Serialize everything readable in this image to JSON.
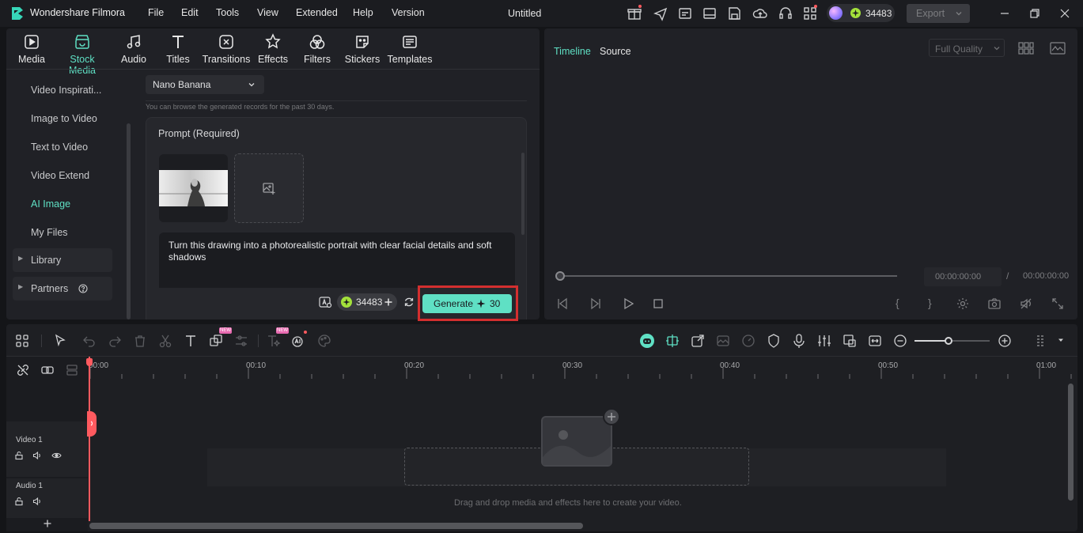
{
  "app": {
    "name": "Wondershare Filmora",
    "doc_title": "Untitled",
    "credits": "34483",
    "export_label": "Export"
  },
  "menu": [
    "File",
    "Edit",
    "Tools",
    "View",
    "Extended",
    "Help",
    "Version"
  ],
  "categories": [
    {
      "label": "Media",
      "icon": "media-icon"
    },
    {
      "label": "Stock Media",
      "icon": "stock-media-icon"
    },
    {
      "label": "Audio",
      "icon": "audio-icon"
    },
    {
      "label": "Titles",
      "icon": "titles-icon"
    },
    {
      "label": "Transitions",
      "icon": "transitions-icon"
    },
    {
      "label": "Effects",
      "icon": "effects-icon"
    },
    {
      "label": "Filters",
      "icon": "filters-icon"
    },
    {
      "label": "Stickers",
      "icon": "stickers-icon"
    },
    {
      "label": "Templates",
      "icon": "templates-icon"
    }
  ],
  "sidebar": {
    "items": [
      "Video Inspirati...",
      "Image to Video",
      "Text to Video",
      "Video Extend",
      "AI Image",
      "My Files"
    ],
    "active": "AI Image",
    "groups": [
      "Library",
      "Partners"
    ]
  },
  "ai_image": {
    "model": "Nano Banana",
    "hint": "You can browse the generated records for the past 30 days.",
    "prompt_label": "Prompt (Required)",
    "prompt_text": "Turn this drawing into a photorealistic portrait with clear facial details and soft shadows",
    "credits": "34483",
    "generate_label": "Generate",
    "generate_cost": "30"
  },
  "player": {
    "tabs": [
      "Timeline",
      "Source"
    ],
    "quality": "Full Quality",
    "current_time": "00:00:00:00",
    "separator": "/",
    "total_time": "00:00:00:00"
  },
  "timeline": {
    "ruler": [
      "00:00",
      "00:10",
      "00:20",
      "00:30",
      "00:40",
      "00:50",
      "01:00"
    ],
    "tracks": [
      "Video 1",
      "Audio 1"
    ],
    "drop_hint": "Drag and drop media and effects here to create your video.",
    "new_badge": "NEW"
  },
  "colors": {
    "accent": "#5fe0c4",
    "highlight": "#d32f2f",
    "playhead": "#ff5a5f"
  }
}
